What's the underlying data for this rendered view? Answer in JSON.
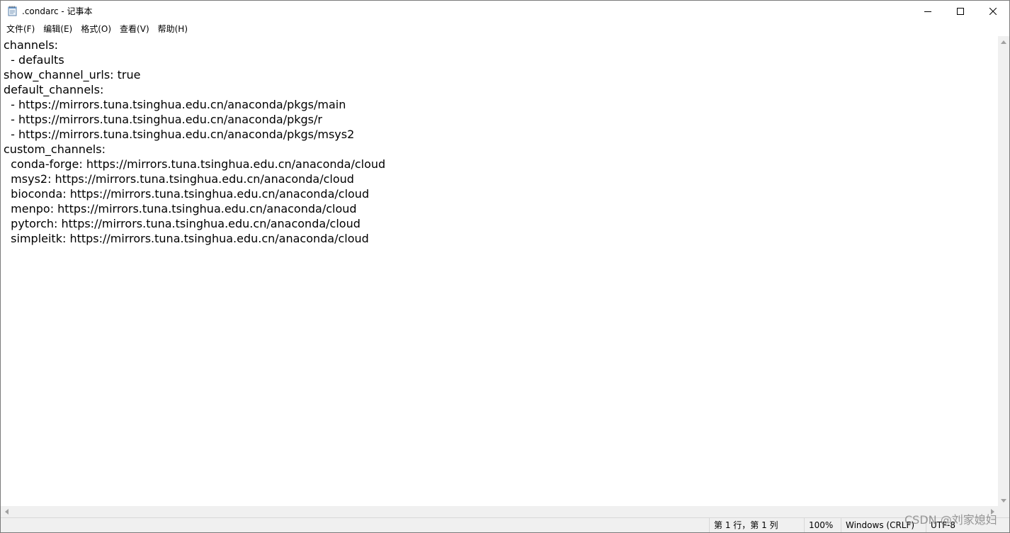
{
  "window": {
    "title": ".condarc - 记事本"
  },
  "menu": {
    "items": [
      {
        "label": "文件(F)"
      },
      {
        "label": "编辑(E)"
      },
      {
        "label": "格式(O)"
      },
      {
        "label": "查看(V)"
      },
      {
        "label": "帮助(H)"
      }
    ]
  },
  "editor": {
    "content": "channels:\n  - defaults\nshow_channel_urls: true\ndefault_channels:\n  - https://mirrors.tuna.tsinghua.edu.cn/anaconda/pkgs/main\n  - https://mirrors.tuna.tsinghua.edu.cn/anaconda/pkgs/r\n  - https://mirrors.tuna.tsinghua.edu.cn/anaconda/pkgs/msys2\ncustom_channels:\n  conda-forge: https://mirrors.tuna.tsinghua.edu.cn/anaconda/cloud\n  msys2: https://mirrors.tuna.tsinghua.edu.cn/anaconda/cloud\n  bioconda: https://mirrors.tuna.tsinghua.edu.cn/anaconda/cloud\n  menpo: https://mirrors.tuna.tsinghua.edu.cn/anaconda/cloud\n  pytorch: https://mirrors.tuna.tsinghua.edu.cn/anaconda/cloud\n  simpleitk: https://mirrors.tuna.tsinghua.edu.cn/anaconda/cloud"
  },
  "status": {
    "position": "第 1 行，第 1 列",
    "zoom": "100%",
    "line_ending": "Windows (CRLF)",
    "encoding": "UTF-8"
  },
  "watermark": "CSDN @刘家媳妇",
  "icons": {
    "app": "notepad-icon",
    "minimize": "minimize-icon",
    "maximize": "maximize-icon",
    "close": "close-icon"
  }
}
